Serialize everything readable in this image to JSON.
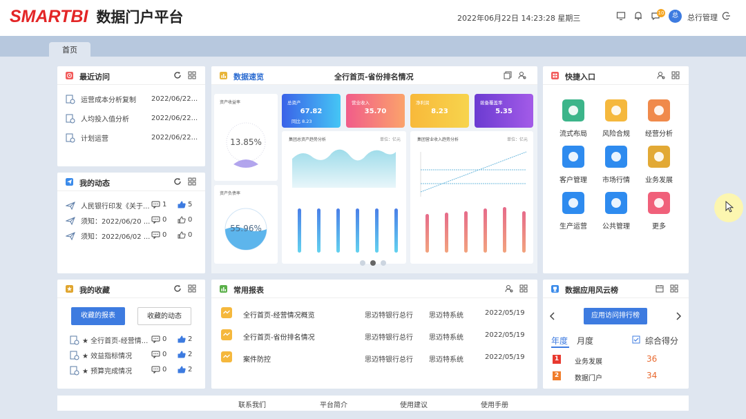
{
  "header": {
    "logo": "SMARTBI",
    "title": "数据门户平台",
    "datetime": "2022年06月22日 14:23:28 星期三",
    "notify_count": "10",
    "avatar": "总",
    "user": "总行管理"
  },
  "tabs": [
    {
      "label": "首页"
    }
  ],
  "recent": {
    "title": "最近访问",
    "items": [
      {
        "name": "运营成本分析复制",
        "date": "2022/06/22..."
      },
      {
        "name": "人均投入值分析",
        "date": "2022/06/22..."
      },
      {
        "name": "计划运营",
        "date": "2022/06/22..."
      }
    ]
  },
  "activity": {
    "title": "我的动态",
    "items": [
      {
        "text": "人民银行印发《关于...",
        "comments": "1",
        "likes": "5"
      },
      {
        "text": "须知：2022/06/20 ...",
        "comments": "0",
        "likes": "0"
      },
      {
        "text": "须知：2022/06/02 ...",
        "comments": "0",
        "likes": "0"
      }
    ]
  },
  "favorites": {
    "title": "我的收藏",
    "tab_active": "收藏的报表",
    "tab_inactive": "收藏的动态",
    "items": [
      {
        "text": "★ 全行首页-经营情...",
        "comments": "0",
        "likes": "2"
      },
      {
        "text": "★ 效益指标情况",
        "comments": "0",
        "likes": "2"
      },
      {
        "text": "★ 预算完成情况",
        "comments": "0",
        "likes": "2"
      }
    ]
  },
  "overview": {
    "title": "数据速览",
    "center_title": "全行首页-省份排名情况",
    "gauge1": {
      "label": "资产收益率",
      "value": "13.85%"
    },
    "gauge2": {
      "label": "资产负债率",
      "value": "55.96%"
    },
    "kpis": [
      {
        "label": "总资产",
        "value": "67.82",
        "sub": "同比 8.23",
        "color1": "#3a62e8",
        "color2": "#45c6f5"
      },
      {
        "label": "营业收入",
        "value": "35.70",
        "sub": "",
        "color1": "#f15c8a",
        "color2": "#fba36b"
      },
      {
        "label": "净利润",
        "value": "8.23",
        "sub": "",
        "color1": "#f8b93a",
        "color2": "#f7d44d"
      },
      {
        "label": "拨备覆盖率",
        "value": "5.35",
        "sub": "",
        "color1": "#6b3bd1",
        "color2": "#a35be8"
      }
    ],
    "chart_left_title": "集团总资产趋势分析",
    "chart_left_unit": "单位：亿元",
    "chart_right_title": "集团营业收入趋势分析",
    "chart_right_unit": "单位：亿元"
  },
  "common_reports": {
    "title": "常用报表",
    "rows": [
      {
        "name": "全行首页-经营情况概览",
        "org": "思迈特银行总行",
        "system": "思迈特系统",
        "date": "2022/05/19"
      },
      {
        "name": "全行首页-省份排名情况",
        "org": "思迈特银行总行",
        "system": "思迈特系统",
        "date": "2022/05/19"
      },
      {
        "name": "案件防控",
        "org": "思迈特银行总行",
        "system": "思迈特系统",
        "date": "2022/05/19"
      }
    ]
  },
  "quick": {
    "title": "快捷入口",
    "items": [
      {
        "label": "流式布局",
        "color": "#3cb58a"
      },
      {
        "label": "风险合规",
        "color": "#f5b83d"
      },
      {
        "label": "经营分析",
        "color": "#f08a4b"
      },
      {
        "label": "客户管理",
        "color": "#2e8bef"
      },
      {
        "label": "市场行情",
        "color": "#2e8bef"
      },
      {
        "label": "业务发展",
        "color": "#e2a935"
      },
      {
        "label": "生产运营",
        "color": "#2e8bef"
      },
      {
        "label": "公共管理",
        "color": "#2e8bef"
      },
      {
        "label": "更多",
        "color": "#f0607a"
      }
    ]
  },
  "ranking": {
    "title": "数据应用风云榜",
    "button": "应用访问排行榜",
    "tab_year": "年度",
    "tab_month": "月度",
    "score_label": "综合得分",
    "rows": [
      {
        "rank": "1",
        "name": "业务发展",
        "score": "36"
      },
      {
        "rank": "2",
        "name": "数据门户",
        "score": "34"
      }
    ]
  },
  "footer": {
    "links": [
      "联系我们",
      "平台简介",
      "使用建议",
      "使用手册"
    ]
  }
}
